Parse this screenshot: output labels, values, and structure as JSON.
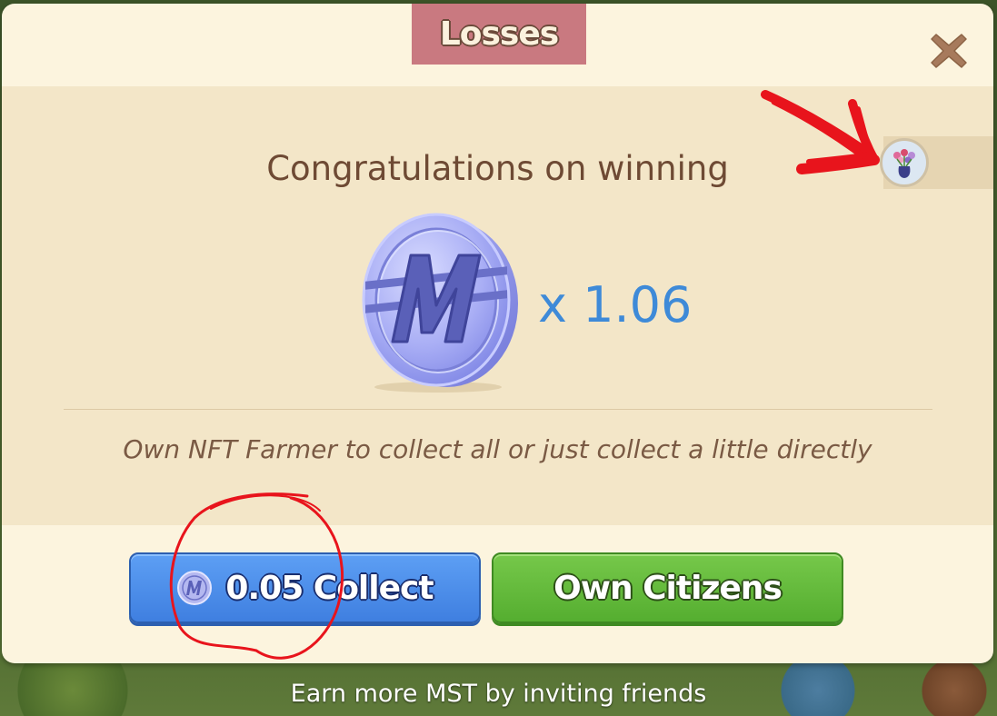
{
  "dialog": {
    "title": "Losses",
    "congrats_text": "Congratulations on winning",
    "reward": {
      "currency_icon": "m-coin-icon",
      "multiplier_text": "x 1.06"
    },
    "hint_text": "Own NFT Farmer to collect all or just collect a little directly",
    "buttons": {
      "collect_label": "0.05 Collect",
      "own_label": "Own Citizens"
    },
    "badge_icon": "flower-vase-icon",
    "close_icon": "close-icon"
  },
  "footer": {
    "invite_text": "Earn more MST by inviting friends"
  },
  "colors": {
    "dialog_bg": "#fcf4de",
    "panel_bg": "#f3e6c8",
    "title_tab": "#c97980",
    "collect_button": "#4a8ae8",
    "own_button": "#62b83a",
    "multiplier_text": "#3e8ad8",
    "annotation_red": "#e8141c"
  }
}
